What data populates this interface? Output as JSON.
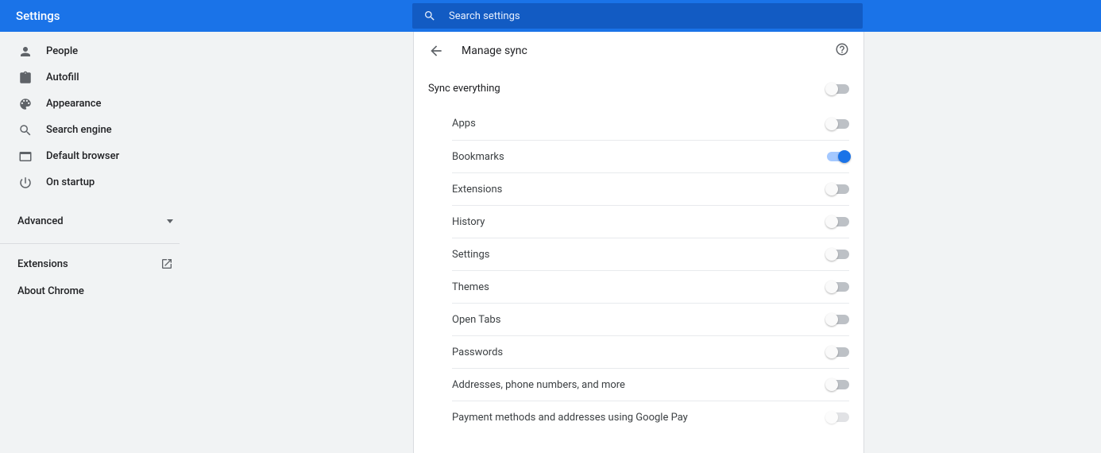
{
  "header": {
    "title": "Settings",
    "search_placeholder": "Search settings"
  },
  "sidebar": {
    "items": [
      {
        "label": "People"
      },
      {
        "label": "Autofill"
      },
      {
        "label": "Appearance"
      },
      {
        "label": "Search engine"
      },
      {
        "label": "Default browser"
      },
      {
        "label": "On startup"
      }
    ],
    "advanced": "Advanced",
    "extensions": "Extensions",
    "about": "About Chrome"
  },
  "panel": {
    "title": "Manage sync",
    "sync_all": "Sync everything",
    "options": [
      {
        "label": "Apps",
        "on": false,
        "disabled": false
      },
      {
        "label": "Bookmarks",
        "on": true,
        "disabled": false
      },
      {
        "label": "Extensions",
        "on": false,
        "disabled": false
      },
      {
        "label": "History",
        "on": false,
        "disabled": false
      },
      {
        "label": "Settings",
        "on": false,
        "disabled": false
      },
      {
        "label": "Themes",
        "on": false,
        "disabled": false
      },
      {
        "label": "Open Tabs",
        "on": false,
        "disabled": false
      },
      {
        "label": "Passwords",
        "on": false,
        "disabled": false
      },
      {
        "label": "Addresses, phone numbers, and more",
        "on": false,
        "disabled": false
      },
      {
        "label": "Payment methods and addresses using Google Pay",
        "on": false,
        "disabled": true
      }
    ]
  }
}
